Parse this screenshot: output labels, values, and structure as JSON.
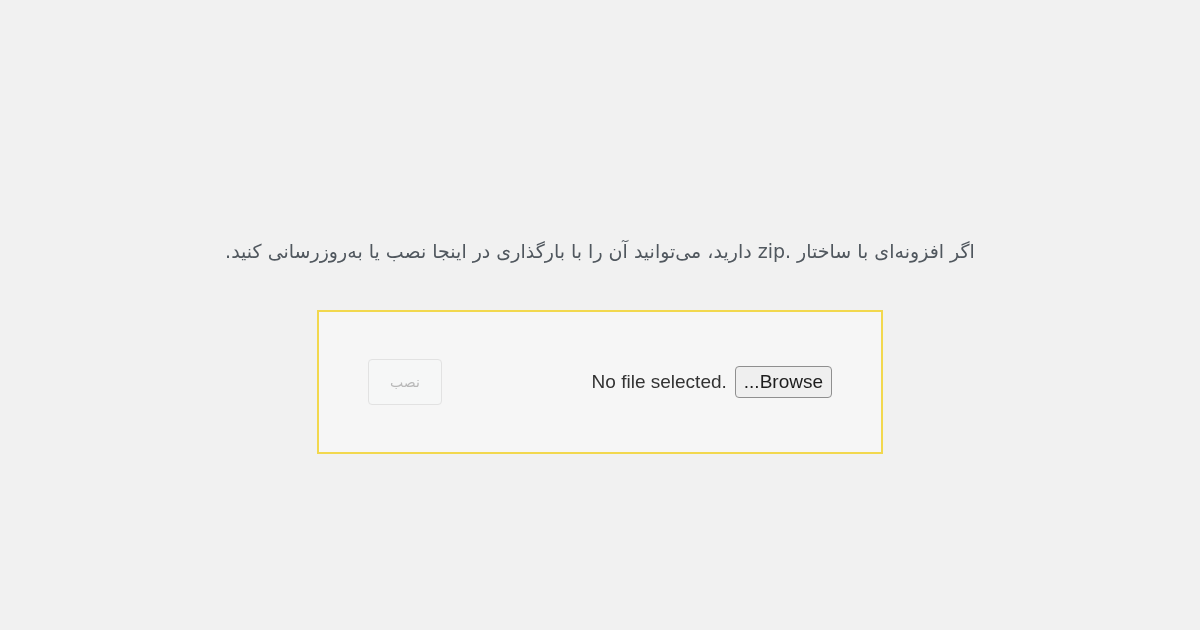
{
  "intro": "اگر افزونه‌ای با ساختار .zip دارید، می‌توانید آن را با بارگذاری در اینجا نصب یا به‌روزرسانی کنید.",
  "upload_form": {
    "file_input": {
      "button": "...Browse",
      "status": "No file selected."
    },
    "install_button": {
      "label": "نصب",
      "disabled": true
    }
  }
}
